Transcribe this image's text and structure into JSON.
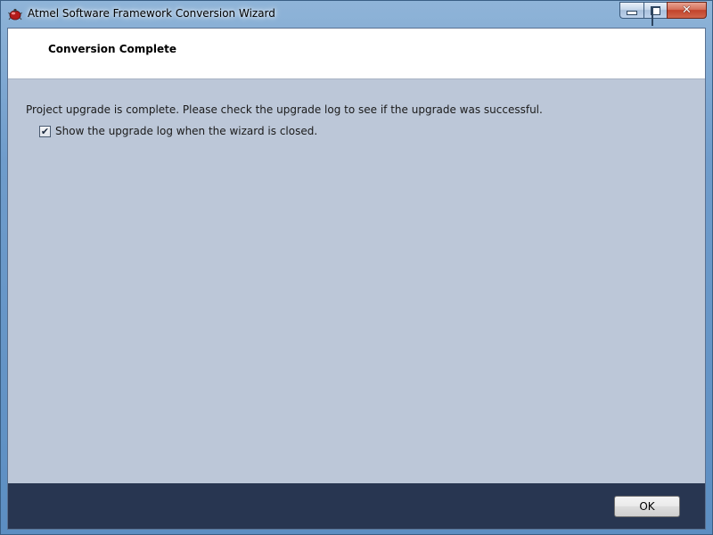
{
  "window": {
    "title": "Atmel Software Framework Conversion Wizard",
    "icon": "atmel-app-icon",
    "close_glyph": "✕"
  },
  "header": {
    "title": "Conversion Complete"
  },
  "main": {
    "message": "Project upgrade is complete. Please check the upgrade log to see if the upgrade was successful.",
    "show_log_checkbox": {
      "label": "Show the upgrade log when the wizard is closed.",
      "checked": true,
      "glyph": "✔"
    }
  },
  "footer": {
    "ok_label": "OK"
  },
  "colors": {
    "client_background": "#bcc7d8",
    "footer_background": "#283651",
    "header_background": "#ffffff"
  }
}
